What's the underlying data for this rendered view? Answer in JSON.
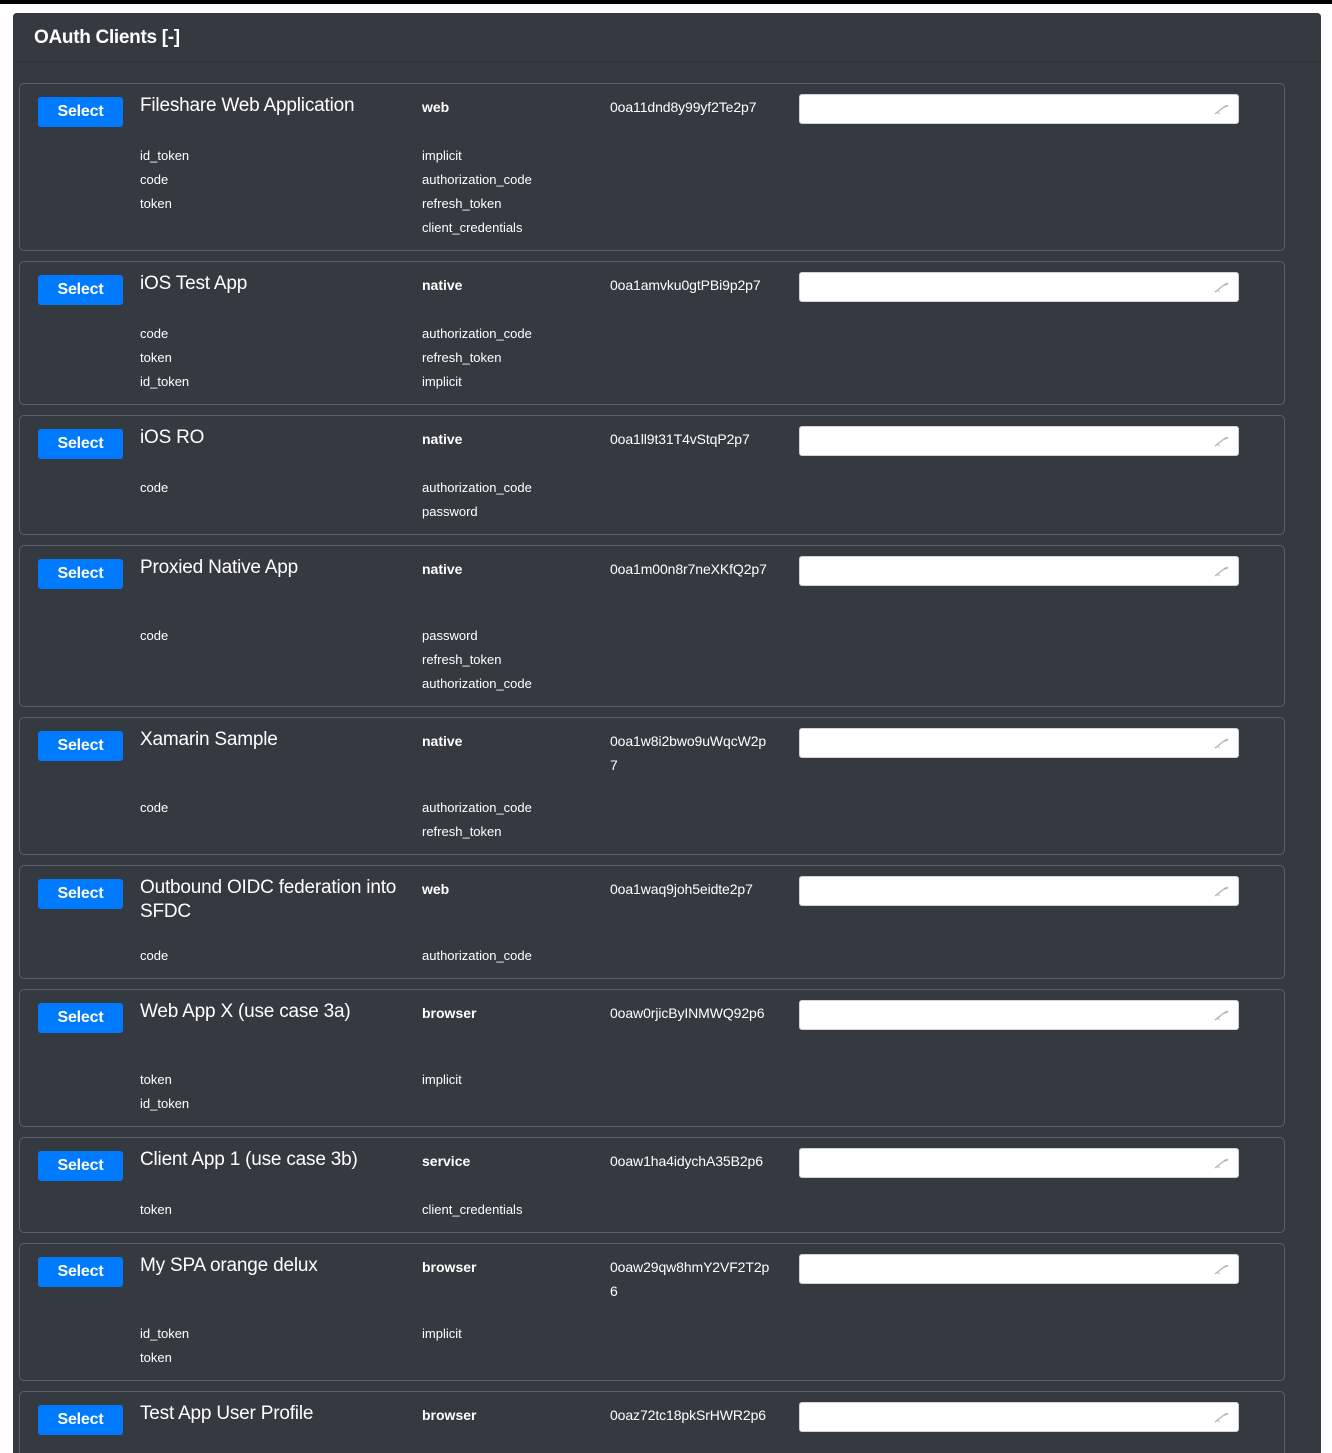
{
  "panel": {
    "title": "OAuth Clients [-]"
  },
  "select_label": "Select",
  "colors": {
    "panel_bg": "#343a40",
    "card_border": "#5b6167",
    "button_bg": "#007bff",
    "text": "#ffffff"
  },
  "clients": [
    {
      "name": "Fileshare Web Application",
      "type": "web",
      "client_id": "0oa11dnd8y99yf2Te2p7",
      "response_types": [
        "id_token",
        "code",
        "token"
      ],
      "grant_types": [
        "implicit",
        "authorization_code",
        "refresh_token",
        "client_credentials"
      ]
    },
    {
      "name": "iOS Test App",
      "type": "native",
      "client_id": "0oa1amvku0gtPBi9p2p7",
      "response_types": [
        "code",
        "token",
        "id_token"
      ],
      "grant_types": [
        "authorization_code",
        "refresh_token",
        "implicit"
      ]
    },
    {
      "name": "iOS RO",
      "type": "native",
      "client_id": "0oa1ll9t31T4vStqP2p7",
      "response_types": [
        "code"
      ],
      "grant_types": [
        "authorization_code",
        "password"
      ]
    },
    {
      "name": "Proxied Native App",
      "type": "native",
      "client_id": "0oa1m00n8r7neXKfQ2p7",
      "response_types": [
        "code"
      ],
      "grant_types": [
        "password",
        "refresh_token",
        "authorization_code"
      ]
    },
    {
      "name": "Xamarin Sample",
      "type": "native",
      "client_id": "0oa1w8i2bwo9uWqcW2p7",
      "response_types": [
        "code"
      ],
      "grant_types": [
        "authorization_code",
        "refresh_token"
      ]
    },
    {
      "name": "Outbound OIDC federation into SFDC",
      "type": "web",
      "client_id": "0oa1waq9joh5eidte2p7",
      "response_types": [
        "code"
      ],
      "grant_types": [
        "authorization_code"
      ]
    },
    {
      "name": "Web App X (use case 3a)",
      "type": "browser",
      "client_id": "0oaw0rjicByINMWQ92p6",
      "response_types": [
        "token",
        "id_token"
      ],
      "grant_types": [
        "implicit"
      ]
    },
    {
      "name": "Client App 1 (use case 3b)",
      "type": "service",
      "client_id": "0oaw1ha4idychA35B2p6",
      "response_types": [
        "token"
      ],
      "grant_types": [
        "client_credentials"
      ]
    },
    {
      "name": "My SPA orange delux",
      "type": "browser",
      "client_id": "0oaw29qw8hmY2VF2T2p6",
      "response_types": [
        "id_token",
        "token"
      ],
      "grant_types": [
        "implicit"
      ]
    },
    {
      "name": "Test App User Profile",
      "type": "browser",
      "client_id": "0oaz72tc18pkSrHWR2p6",
      "response_types": [],
      "grant_types": []
    }
  ]
}
